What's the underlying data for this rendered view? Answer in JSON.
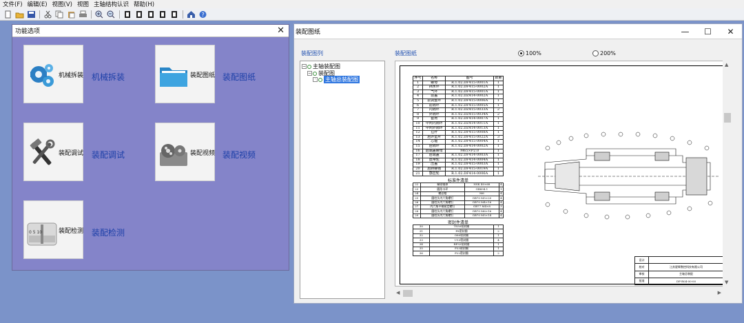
{
  "menu": [
    "文件(F)",
    "编辑(E)",
    "视图(V)",
    "视图",
    "主轴结构认识",
    "帮助(H)"
  ],
  "toolbar_icons": [
    "new-icon",
    "open-icon",
    "save-icon",
    "sep",
    "cut-icon",
    "copy-icon",
    "paste-icon",
    "print-icon",
    "sep",
    "zoom-in-icon",
    "zoom-out-icon",
    "sep",
    "page-first-icon",
    "page-prev-icon",
    "page-next-icon",
    "page-last-icon",
    "page-icon",
    "sep",
    "home-icon",
    "help-icon"
  ],
  "function_window": {
    "title": "功能选项",
    "tiles": [
      {
        "label": "机械拆装",
        "link": "机械拆装",
        "icon": "gears-icon"
      },
      {
        "label": "装配图纸",
        "link": "装配图纸",
        "icon": "folder-icon"
      },
      {
        "label": "装配调试",
        "link": "装配调试",
        "icon": "tools-icon"
      },
      {
        "label": "装配视频",
        "link": "装配视频",
        "icon": "film-reel-icon"
      },
      {
        "label": "装配检测",
        "link": "装配检测",
        "icon": "caliper-icon"
      }
    ]
  },
  "assembly_window": {
    "title": "装配图纸",
    "tree_label": "装配图列",
    "drawing_label": "装配图纸",
    "tree": [
      {
        "label": "主轴装配图",
        "level": 0
      },
      {
        "label": "装配图",
        "level": 1
      },
      {
        "label": "主轴总装配图",
        "level": 2,
        "selected": true
      }
    ],
    "zoom_options": [
      {
        "label": "100%",
        "checked": true
      },
      {
        "label": "200%",
        "checked": false
      }
    ]
  },
  "drawing": {
    "parts_header": [
      "序号",
      "名称",
      "图号",
      "数量"
    ],
    "parts": [
      [
        "1",
        "螺母",
        "R.1.02.DF415-0001A",
        "1"
      ],
      [
        "2",
        "挡水环",
        "R.1.02.DF415-0002A",
        "1"
      ],
      [
        "3",
        "气环",
        "R.1.02.DF415-0001A",
        "1"
      ],
      [
        "4",
        "前盖",
        "R.1.02.DZ414-0002A",
        "1"
      ],
      [
        "5",
        "前调整环",
        "R.1.02.DF415-0006A",
        "1"
      ],
      [
        "6",
        "前隔环",
        "R.1.02.DF415-0005A",
        "1"
      ],
      [
        "7",
        "内隔环",
        "R.1.02.DZ415-0033A",
        "2"
      ],
      [
        "8",
        "外隔环",
        "R.1.02.DZ415-0034A",
        "2"
      ],
      [
        "9",
        "套筒",
        "R.1.02.DF414-0007A",
        "1"
      ],
      [
        "10",
        "中间内隔环",
        "R.1.02.DZ414-0011A",
        "1"
      ],
      [
        "11",
        "中间外隔环",
        "R.1.02.DZ414-0013A",
        "1"
      ],
      [
        "12",
        "拉杆",
        "R.1.02.DF415-0008A",
        "1"
      ],
      [
        "13",
        "后外垫片",
        "R.1.02.DF415-0022A",
        "3"
      ],
      [
        "14",
        "芯轴",
        "R.1.02.DF415-0004A",
        "1"
      ],
      [
        "15",
        "后隔环",
        "R.1.02.DF414-0002A",
        "1"
      ],
      [
        "16",
        "后端盖螺母",
        "M65×P2.0",
        "1"
      ],
      [
        "17",
        "后端盖",
        "R.1.02.DF414-0003A",
        "1"
      ],
      [
        "18",
        "皮带轮",
        "R.1.02.DF414-0004A",
        "1"
      ],
      [
        "19",
        "压盖",
        "R.1.02.DF415-0003A",
        "1"
      ],
      [
        "20",
        "后转螺帽",
        "R.1.02.DF415-0019A",
        "1"
      ],
      [
        "21",
        "感应轮",
        "R.1.02.DF414-0006A",
        "1"
      ]
    ],
    "std_title": "标准件清单",
    "std_parts": [
      [
        "22",
        "精密轴承",
        "NSK 40×68",
        "4"
      ],
      [
        "23",
        "圆形卡环",
        "GB894.1",
        "1"
      ],
      [
        "24",
        "螺丝帽",
        "M6",
        "4"
      ],
      [
        "25",
        "圆柱头内六角螺钉",
        "GB70 M5×20",
        "4"
      ],
      [
        "26",
        "圆柱头内六角螺钉",
        "GB70 M4×16",
        "4"
      ],
      [
        "27",
        "内六角平端紧定螺钉",
        "GB77 M4×8",
        "3"
      ],
      [
        "28",
        "圆柱头内六角螺钉",
        "GB70 M6×16",
        "4"
      ],
      [
        "29",
        "圆柱头内六角螺钉",
        "GB70 M5×14",
        "4"
      ]
    ],
    "seal_title": "密封件清单",
    "seal_parts": [
      [
        "30",
        "TS50密封圈",
        "1"
      ],
      [
        "31",
        "P8密封圈",
        "2"
      ],
      [
        "32",
        "O80密封圈",
        "1"
      ],
      [
        "33",
        "U13密封圈",
        "4"
      ],
      [
        "34",
        "RP32密封圈",
        "1"
      ],
      [
        "35",
        "P33密封圈",
        "1"
      ],
      [
        "36",
        "P22密封圈",
        "2"
      ]
    ],
    "title_block": {
      "rows": [
        "设计",
        "校对",
        "审核",
        "批准"
      ],
      "company": "江苏星辉数控科技有限公司",
      "part_name": "主轴总装配",
      "drawing_no": "DF-R04-00-00"
    }
  }
}
